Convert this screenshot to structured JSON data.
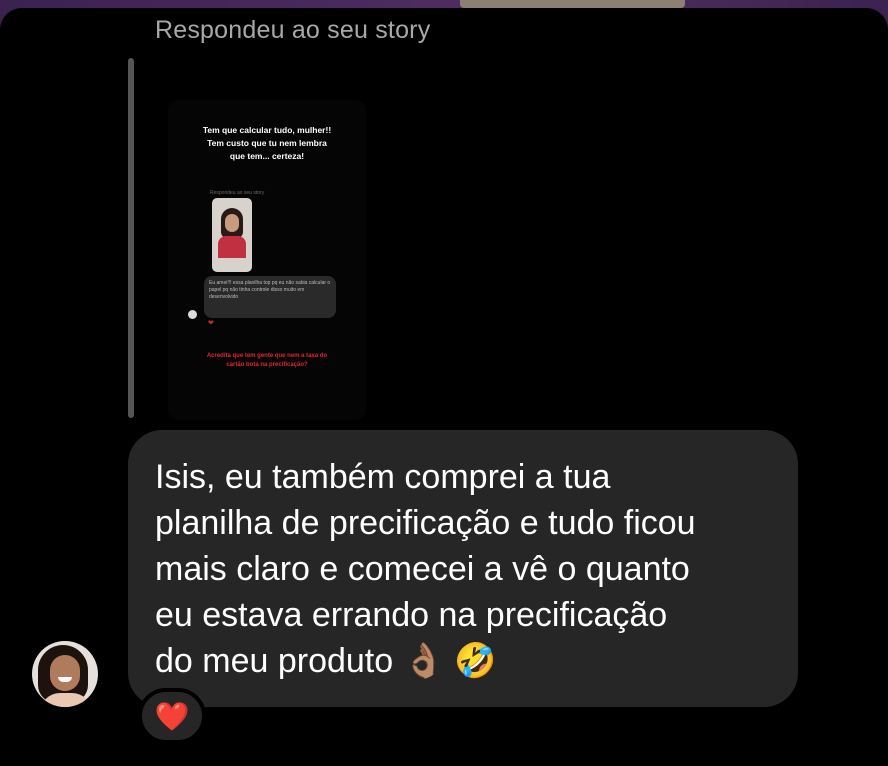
{
  "reply_label": "Respondeu ao seu story",
  "story": {
    "title_lines": [
      "Tem que calcular tudo, mulher!!",
      "Tem custo que tu nem lembra",
      "que tem... certeza!"
    ],
    "reply_label": "Respondeu ao seu story",
    "bubble_text": "Eu amei!!! essa planilha top pq eu não sabia calcular o papel pq não tinha controle disso muito em desenvolvido",
    "heart": "❤",
    "caption_lines": [
      "Acredita que tem gente que nem a taxa do",
      "cartão bota na precificação?"
    ]
  },
  "message": {
    "lines": [
      "Isis, eu também comprei a tua",
      "planilha de precificação e tudo ficou",
      "mais claro e comecei a vê o quanto",
      "eu estava errando na precificação",
      "do meu produto 👌🏽 🤣"
    ]
  },
  "reaction": {
    "emoji": "❤️"
  },
  "colors": {
    "background": "#000000",
    "bubble": "#262626",
    "reply_label": "#a8a8a8",
    "heart": "#e0102a",
    "story_caption": "#e0243a"
  },
  "icons": {
    "reaction": "red-heart-icon",
    "avatar": "user-avatar",
    "quote": "quote-bar"
  }
}
